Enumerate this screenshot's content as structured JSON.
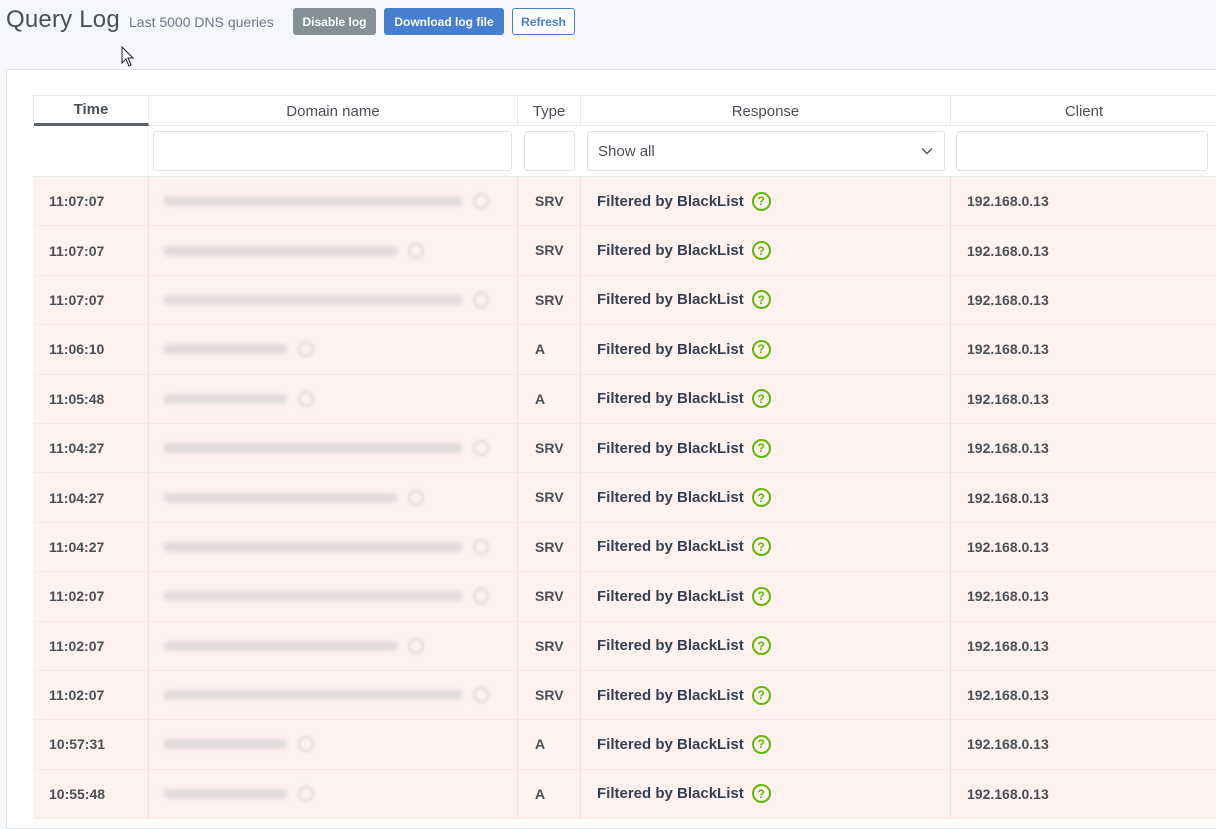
{
  "header": {
    "title": "Query Log",
    "subtitle": "Last 5000 DNS queries",
    "buttons": {
      "disable": "Disable log",
      "download": "Download log file",
      "refresh": "Refresh"
    }
  },
  "table": {
    "columns": {
      "time": "Time",
      "domain": "Domain name",
      "type": "Type",
      "response": "Response",
      "client": "Client"
    },
    "sorted_column": "Time",
    "response_filter": "Show all",
    "rows": [
      {
        "time": "11:07:07",
        "type": "SRV",
        "response": "Filtered by BlackList",
        "client": "192.168.0.13"
      },
      {
        "time": "11:07:07",
        "type": "SRV",
        "response": "Filtered by BlackList",
        "client": "192.168.0.13"
      },
      {
        "time": "11:07:07",
        "type": "SRV",
        "response": "Filtered by BlackList",
        "client": "192.168.0.13"
      },
      {
        "time": "11:06:10",
        "type": "A",
        "response": "Filtered by BlackList",
        "client": "192.168.0.13"
      },
      {
        "time": "11:05:48",
        "type": "A",
        "response": "Filtered by BlackList",
        "client": "192.168.0.13"
      },
      {
        "time": "11:04:27",
        "type": "SRV",
        "response": "Filtered by BlackList",
        "client": "192.168.0.13"
      },
      {
        "time": "11:04:27",
        "type": "SRV",
        "response": "Filtered by BlackList",
        "client": "192.168.0.13"
      },
      {
        "time": "11:04:27",
        "type": "SRV",
        "response": "Filtered by BlackList",
        "client": "192.168.0.13"
      },
      {
        "time": "11:02:07",
        "type": "SRV",
        "response": "Filtered by BlackList",
        "client": "192.168.0.13"
      },
      {
        "time": "11:02:07",
        "type": "SRV",
        "response": "Filtered by BlackList",
        "client": "192.168.0.13"
      },
      {
        "time": "11:02:07",
        "type": "SRV",
        "response": "Filtered by BlackList",
        "client": "192.168.0.13"
      },
      {
        "time": "10:57:31",
        "type": "A",
        "response": "Filtered by BlackList",
        "client": "192.168.0.13"
      },
      {
        "time": "10:55:48",
        "type": "A",
        "response": "Filtered by BlackList",
        "client": "192.168.0.13"
      }
    ]
  },
  "colors": {
    "primary": "#467fcf",
    "secondary": "#868e96",
    "row_filtered_bg": "#fff1f0",
    "help_icon": "#5eba00"
  },
  "icons": {
    "help": "question-circle-icon",
    "chevron": "chevron-down-icon",
    "cursor": "mouse-cursor-icon"
  }
}
